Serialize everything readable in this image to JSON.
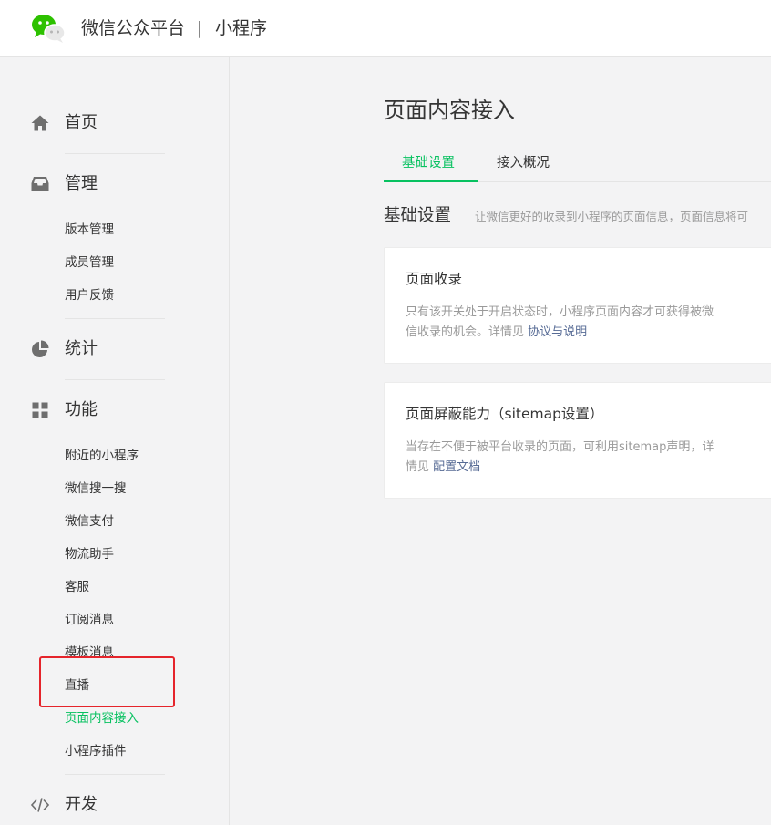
{
  "header": {
    "title": "微信公众平台",
    "separator": "|",
    "subtitle": "小程序",
    "logo_icon": "wechat-logo-icon"
  },
  "sidebar": {
    "home": {
      "label": "首页",
      "icon": "home-icon"
    },
    "manage": {
      "label": "管理",
      "icon": "inbox-icon",
      "items": [
        "版本管理",
        "成员管理",
        "用户反馈"
      ]
    },
    "stats": {
      "label": "统计",
      "icon": "pie-chart-icon"
    },
    "features": {
      "label": "功能",
      "icon": "grid-icon",
      "items": [
        "附近的小程序",
        "微信搜一搜",
        "微信支付",
        "物流助手",
        "客服",
        "订阅消息",
        "模板消息",
        "直播",
        "页面内容接入",
        "小程序插件"
      ],
      "active_item": "页面内容接入"
    },
    "dev": {
      "label": "开发",
      "icon": "code-icon"
    }
  },
  "main": {
    "page_title": "页面内容接入",
    "tabs": [
      {
        "label": "基础设置",
        "active": true
      },
      {
        "label": "接入概况",
        "active": false
      }
    ],
    "section": {
      "title": "基础设置",
      "description": "让微信更好的收录到小程序的页面信息，页面信息将可"
    },
    "cards": [
      {
        "title": "页面收录",
        "description": "只有该开关处于开启状态时，小程序页面内容才可获得被微信收录的机会。详情见",
        "link": "协议与说明"
      },
      {
        "title": "页面屏蔽能力（sitemap设置）",
        "description": "当存在不便于被平台收录的页面，可利用sitemap声明，详情见",
        "link": "配置文档"
      }
    ]
  },
  "colors": {
    "accent": "#07c160",
    "link": "#576b95",
    "highlight": "#e5242b",
    "background": "#f3f3f4"
  }
}
